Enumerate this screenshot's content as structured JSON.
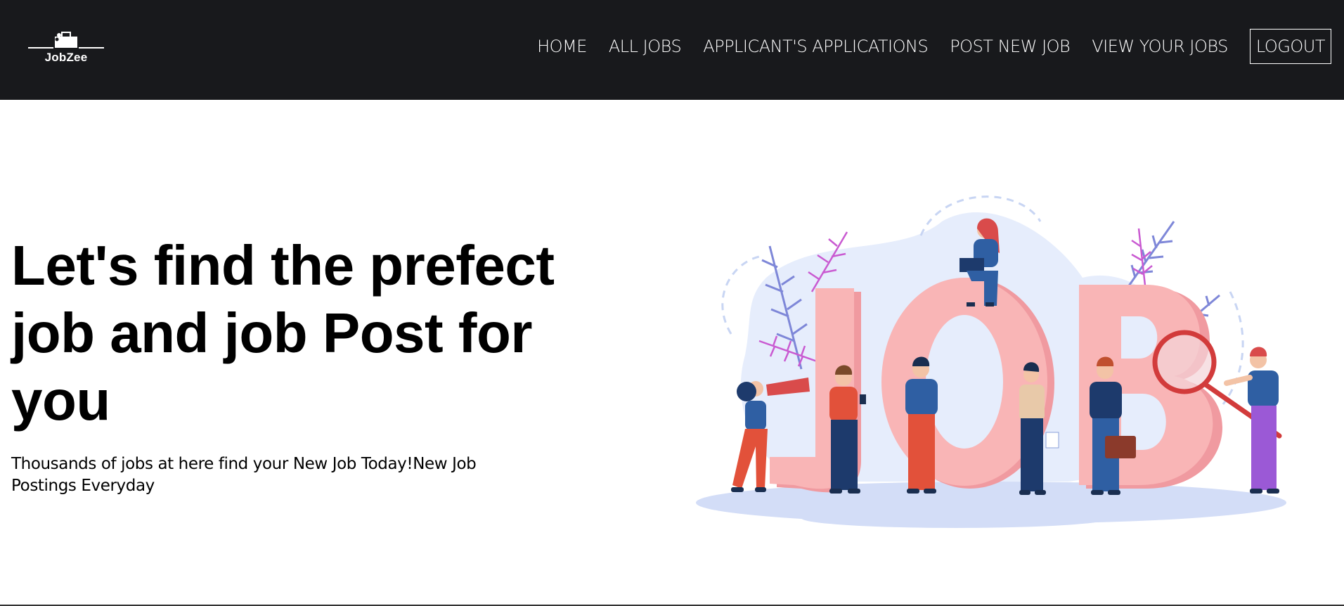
{
  "brand": {
    "name": "JobZee",
    "icon": "briefcase-logo-icon"
  },
  "nav": {
    "links": [
      {
        "label": "HOME"
      },
      {
        "label": "ALL JOBS"
      },
      {
        "label": "APPLICANT'S APPLICATIONS"
      },
      {
        "label": "POST NEW JOB"
      },
      {
        "label": "VIEW YOUR JOBS"
      }
    ],
    "logout": "LOGOUT"
  },
  "hero": {
    "title": "Let's find the prefect job and job Post for you",
    "subtitle": "Thousands of jobs at here find your New Job Today!New Job Postings Everyday",
    "illustration_icon": "job-search-people-illustration"
  },
  "colors": {
    "navbar_bg": "#18191c",
    "page_bg": "#ffffff",
    "letters_pink": "#f7b0b0",
    "accent_blue": "#2f5fa3"
  }
}
